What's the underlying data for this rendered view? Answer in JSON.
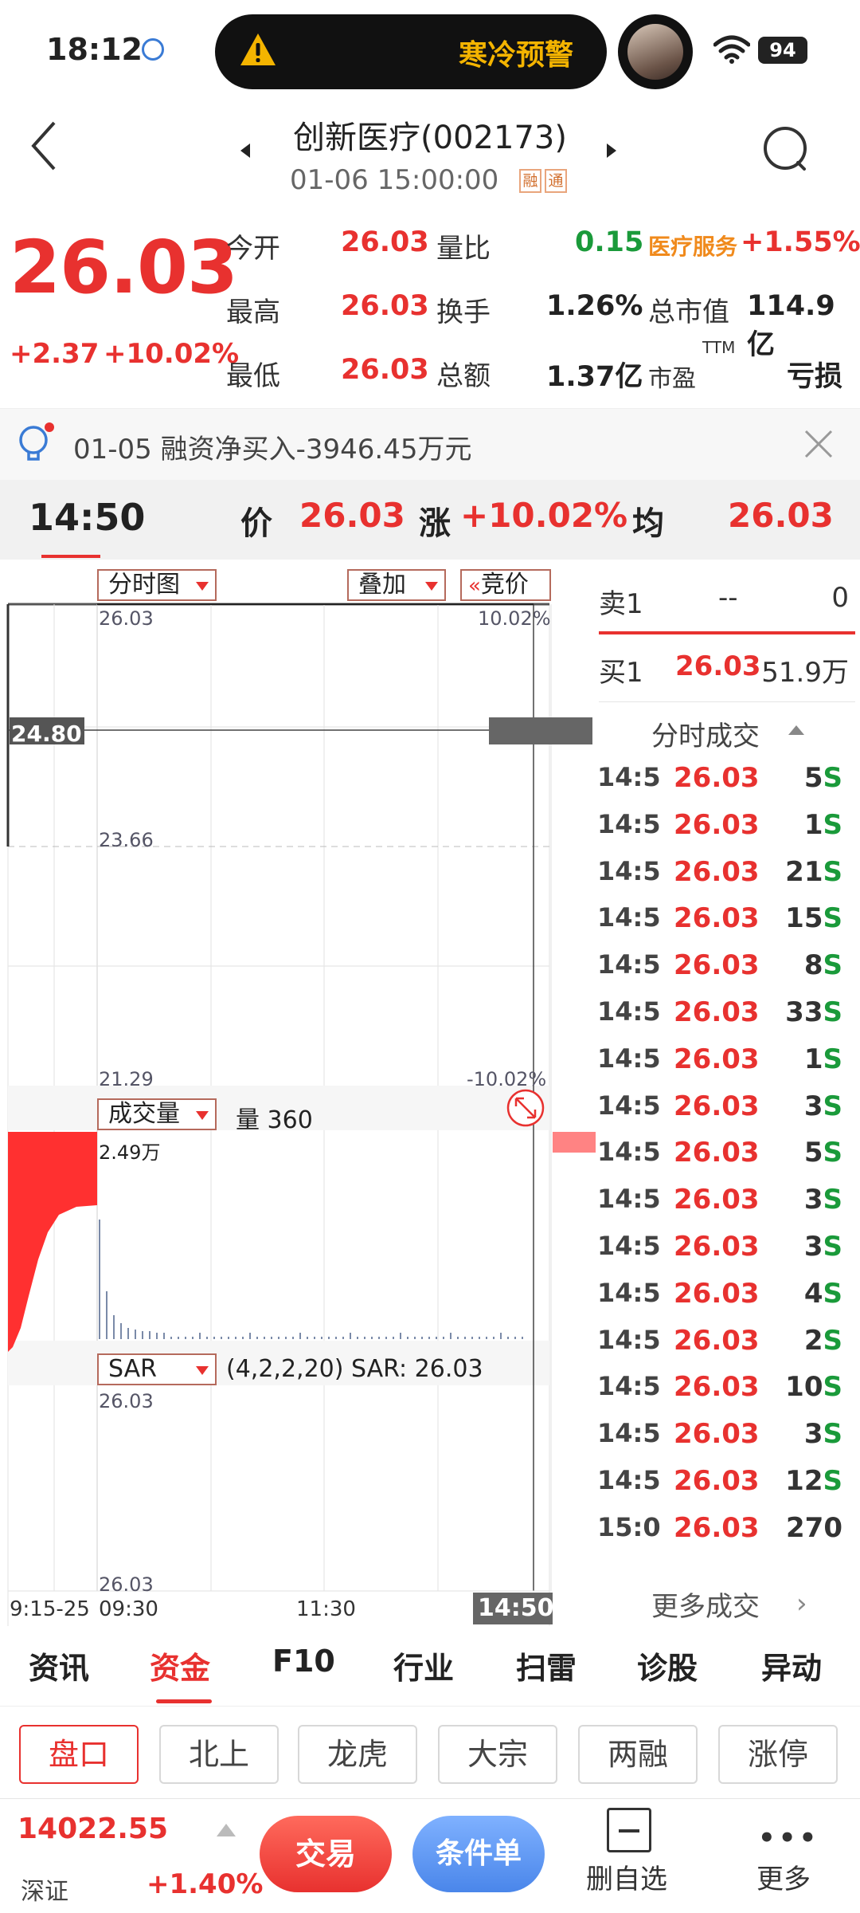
{
  "status_bar": {
    "time": "18:12",
    "alert": "寒冷预警",
    "battery": "94"
  },
  "header": {
    "title": "创新医疗(002173)",
    "datetime": "01-06 15:00:00",
    "tag_margin": "融",
    "tag_connect": "通"
  },
  "quote": {
    "price": "26.03",
    "change": "+2.37",
    "change_pct": "+10.02%",
    "stats": {
      "open_label": "今开",
      "open": "26.03",
      "ratio_label": "量比",
      "ratio": "0.15",
      "sector_label": "医疗服务",
      "sector_pct": "+1.55%",
      "high_label": "最高",
      "high": "26.03",
      "turnover_label": "换手",
      "turnover": "1.26%",
      "mktcap_label": "总市值",
      "mktcap": "114.9亿",
      "low_label": "最低",
      "low": "26.03",
      "amount_label": "总额",
      "amount": "1.37亿",
      "pe_label": "市盈",
      "pe_sup": "TTM",
      "pe": "亏损"
    }
  },
  "notice": {
    "text": "01-05 融资净买入-3946.45万元"
  },
  "crosshair": {
    "time": "14:50",
    "price_label": "价",
    "price": "26.03",
    "change_label": "涨",
    "change": "+10.02%",
    "avg_label": "均",
    "avg": "26.03"
  },
  "chart": {
    "type_selector": "分时图",
    "overlay_selector": "叠加",
    "auction_button": "竞价",
    "top_price": "26.03",
    "top_pct": "10.02%",
    "mid_price": "23.66",
    "bottom_price": "21.29",
    "bottom_pct": "-10.02%",
    "cross_price": "24.80",
    "volume_selector": "成交量",
    "volume_label": "量 360",
    "volume_max": "2.49万",
    "indicator_selector": "SAR",
    "indicator_params": "(4,2,2,20) SAR: 26.03",
    "sar_top": "26.03",
    "sar_bottom": "26.03",
    "time_axis": {
      "auction": "9:15-25",
      "open": "09:30",
      "mid": "11:30",
      "cursor": "14:50"
    }
  },
  "order_book": {
    "sell1": {
      "label": "卖1",
      "price": "--",
      "volume": "0"
    },
    "buy1": {
      "label": "买1",
      "price": "26.03",
      "volume": "51.9万"
    }
  },
  "ticks": {
    "title": "分时成交",
    "more": "更多成交",
    "rows": [
      {
        "time": "14:5",
        "price": "26.03",
        "vol": "5",
        "flag": "S"
      },
      {
        "time": "14:5",
        "price": "26.03",
        "vol": "1",
        "flag": "S"
      },
      {
        "time": "14:5",
        "price": "26.03",
        "vol": "21",
        "flag": "S"
      },
      {
        "time": "14:5",
        "price": "26.03",
        "vol": "15",
        "flag": "S"
      },
      {
        "time": "14:5",
        "price": "26.03",
        "vol": "8",
        "flag": "S"
      },
      {
        "time": "14:5",
        "price": "26.03",
        "vol": "33",
        "flag": "S"
      },
      {
        "time": "14:5",
        "price": "26.03",
        "vol": "1",
        "flag": "S"
      },
      {
        "time": "14:5",
        "price": "26.03",
        "vol": "3",
        "flag": "S"
      },
      {
        "time": "14:5",
        "price": "26.03",
        "vol": "5",
        "flag": "S"
      },
      {
        "time": "14:5",
        "price": "26.03",
        "vol": "3",
        "flag": "S"
      },
      {
        "time": "14:5",
        "price": "26.03",
        "vol": "3",
        "flag": "S"
      },
      {
        "time": "14:5",
        "price": "26.03",
        "vol": "4",
        "flag": "S"
      },
      {
        "time": "14:5",
        "price": "26.03",
        "vol": "2",
        "flag": "S"
      },
      {
        "time": "14:5",
        "price": "26.03",
        "vol": "10",
        "flag": "S"
      },
      {
        "time": "14:5",
        "price": "26.03",
        "vol": "3",
        "flag": "S"
      },
      {
        "time": "14:5",
        "price": "26.03",
        "vol": "12",
        "flag": "S"
      },
      {
        "time": "15:0",
        "price": "26.03",
        "vol": "270",
        "flag": ""
      }
    ]
  },
  "main_tabs": [
    "资讯",
    "资金",
    "F10",
    "行业",
    "扫雷",
    "诊股",
    "异动"
  ],
  "sub_tabs": [
    "盘口",
    "北上",
    "龙虎",
    "大宗",
    "两融",
    "涨停"
  ],
  "bottom_bar": {
    "index_value": "14022.55",
    "index_name": "深证",
    "index_pct": "+1.40%",
    "trade": "交易",
    "condition": "条件单",
    "remove_watch": "删自选",
    "more": "更多"
  },
  "colors": {
    "up": "#e8312f",
    "down": "#1a9a3a",
    "accent": "#e8312f",
    "sector": "#f08a1c"
  }
}
